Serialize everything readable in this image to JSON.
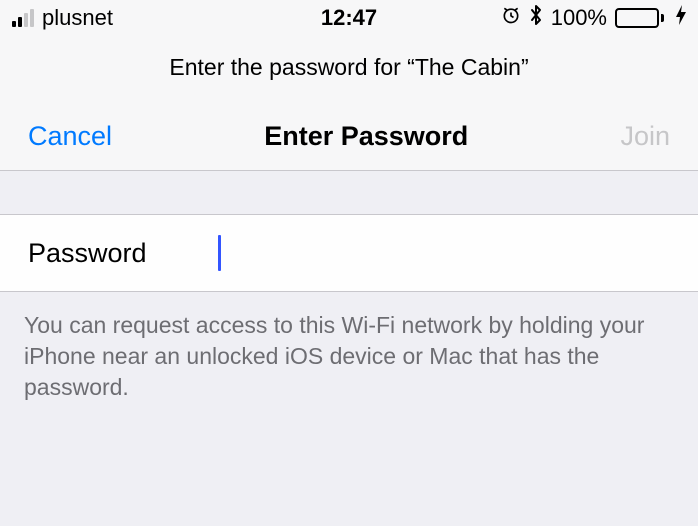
{
  "status_bar": {
    "carrier": "plusnet",
    "time": "12:47",
    "battery_pct": "100%",
    "icons": {
      "alarm": "⏰",
      "bluetooth": "✱",
      "bolt": "⚡︎"
    }
  },
  "prompt": {
    "text": "Enter the password for “The Cabin”"
  },
  "nav": {
    "cancel": "Cancel",
    "title": "Enter Password",
    "join": "Join"
  },
  "form": {
    "password_label": "Password",
    "password_value": "",
    "password_placeholder": ""
  },
  "helper": {
    "text": "You can request access to this Wi-Fi network by holding your iPhone near an unlocked iOS device or Mac that has the password."
  }
}
